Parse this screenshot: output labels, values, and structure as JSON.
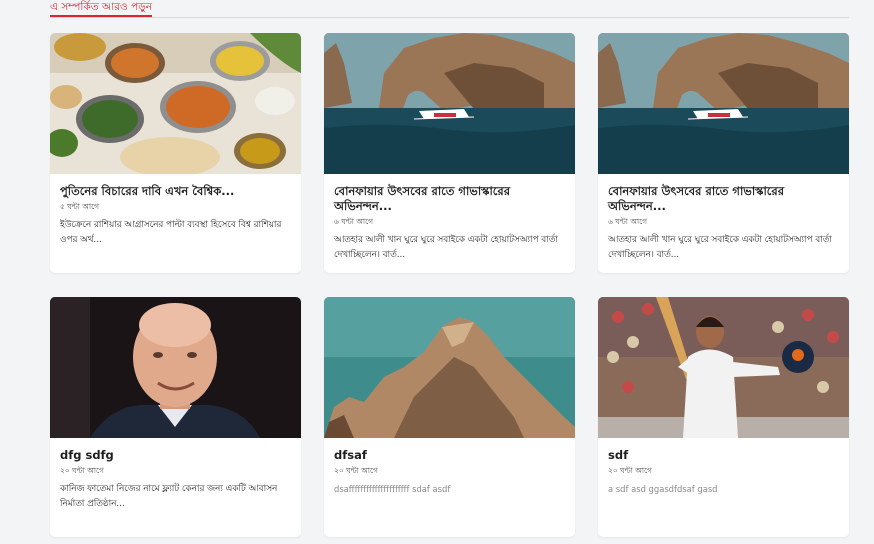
{
  "section": {
    "heading": "এ সম্পর্কিত আরও পড়ুন"
  },
  "cards": [
    {
      "image": "food-platter",
      "title": "পুতিনের বিচারের দাবি এখন বৈশ্বিক...",
      "time": "৫ ঘন্টা আগে",
      "excerpt": "ইউক্রেনে রাশিয়ার আগ্রাসনের পাল্টা ব্যবস্থা হিসেবে বিশ্ব রাশিয়ার ওপর অর্থ..."
    },
    {
      "image": "sea-arch-boat",
      "title": "বোনফায়ার উৎসবের রাতে গাভাস্কারের অভিনন্দন...",
      "time": "৬ ঘন্টা আগে",
      "excerpt": "আতহার আলী খান ঘুরে ঘুরে সবাইকে একটা হোয়াটসঅ্যাপ বার্তা দেখাচ্ছিলেন। বার্ত..."
    },
    {
      "image": "sea-arch-boat",
      "title": "বোনফায়ার উৎসবের রাতে গাভাস্কারের অভিনন্দন...",
      "time": "৬ ঘন্টা আগে",
      "excerpt": "আতহার আলী খান ঘুরে ঘুরে সবাইকে একটা হোয়াটসঅ্যাপ বার্তা দেখাচ্ছিলেন। বার্ত..."
    },
    {
      "image": "portrait-man",
      "title": "dfg sdfg",
      "time": "২০ ঘন্টা আগে",
      "excerpt": "কানিজ ফাতেমা নিজের নামে ফ্ল্যাট কেনার জন্য একটি আবাসন নির্মাতা প্রতিষ্ঠান..."
    },
    {
      "image": "rocky-cliff",
      "title": "dfsaf",
      "time": "২০ ঘন্টা আগে",
      "excerpt": "dsafffffffffffffffffffff sdaf asdf"
    },
    {
      "image": "cricketer",
      "title": "sdf",
      "time": "২০ ঘন্টা আগে",
      "excerpt": "a sdf asd ggasdfdsaf gasd"
    }
  ]
}
